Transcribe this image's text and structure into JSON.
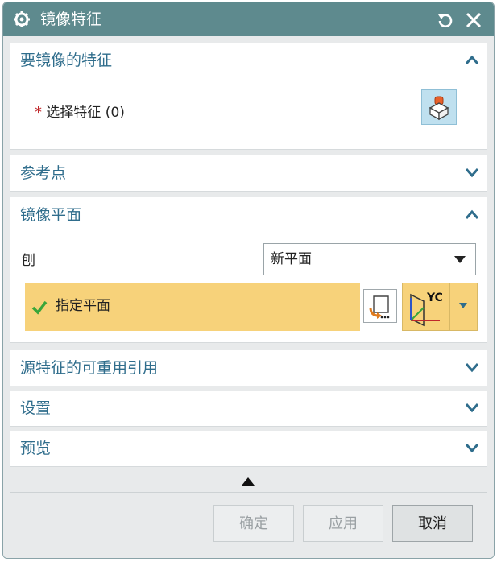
{
  "window": {
    "title": "镜像特征"
  },
  "sections": {
    "mirror_features": {
      "label": "要镜像的特征",
      "expanded": true,
      "select_label": "选择特征 (0)",
      "required_mark": "*"
    },
    "reference_point": {
      "label": "参考点",
      "expanded": false
    },
    "mirror_plane": {
      "label": "镜像平面",
      "expanded": true,
      "plane_label": "刨",
      "plane_value": "新平面",
      "specify_label": "指定平面",
      "plane_type_icon_text": "YC"
    },
    "reuse_refs": {
      "label": "源特征的可重用引用",
      "expanded": false
    },
    "settings": {
      "label": "设置",
      "expanded": false
    },
    "preview": {
      "label": "预览",
      "expanded": false
    }
  },
  "buttons": {
    "ok": "确定",
    "apply": "应用",
    "cancel": "取消"
  },
  "colors": {
    "titlebar": "#5e8a8e",
    "section_label": "#2f6d8c",
    "highlight": "#f7d27a",
    "check": "#3aa63a",
    "required": "#c0282b"
  },
  "icons": {
    "title": "gear-icon",
    "reset": "reset-icon",
    "close": "close-icon",
    "feature_select": "feature-select-icon",
    "plane_dialog": "plane-dialog-icon",
    "plane_type": "yc-plane-icon"
  }
}
